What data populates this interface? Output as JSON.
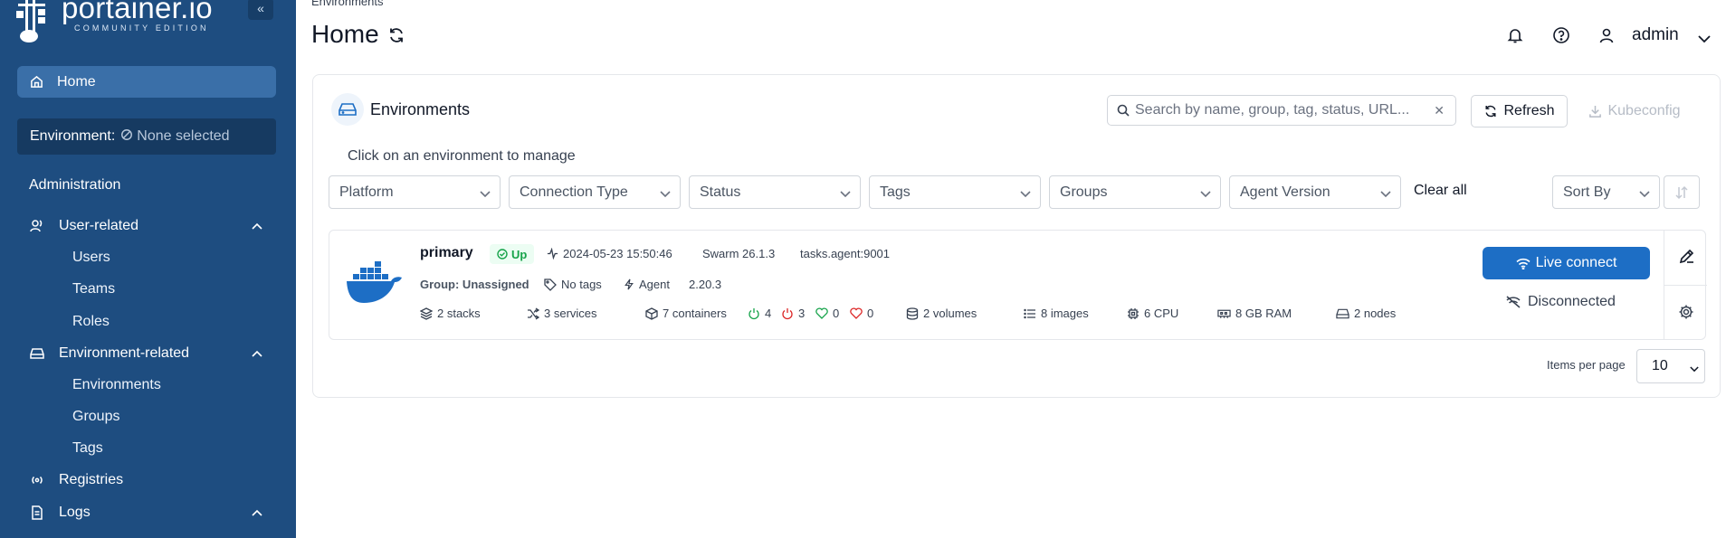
{
  "brand": {
    "title": "portainer.io",
    "subtitle": "COMMUNITY EDITION",
    "collapse": "«"
  },
  "sidebar": {
    "home": "Home",
    "environment_label": "Environment:",
    "environment_value": "None selected",
    "administration": "Administration",
    "user_related": "User-related",
    "users": "Users",
    "teams": "Teams",
    "roles": "Roles",
    "environment_related": "Environment-related",
    "environments": "Environments",
    "groups": "Groups",
    "tags": "Tags",
    "registries": "Registries",
    "logs": "Logs"
  },
  "header": {
    "breadcrumb": "Environments",
    "title": "Home",
    "user": "admin"
  },
  "panel": {
    "title": "Environments",
    "hint": "Click on an environment to manage",
    "search_placeholder": "Search by name, group, tag, status, URL...",
    "refresh": "Refresh",
    "kubeconfig": "Kubeconfig"
  },
  "filters": {
    "platform": "Platform",
    "connection_type": "Connection Type",
    "status": "Status",
    "tags": "Tags",
    "groups": "Groups",
    "agent_version": "Agent Version",
    "clear_all": "Clear all",
    "sort_by": "Sort By"
  },
  "environment": {
    "name": "primary",
    "status": "Up",
    "timestamp": "2024-05-23 15:50:46",
    "swarm": "Swarm 26.1.3",
    "url": "tasks.agent:9001",
    "group": "Group: Unassigned",
    "tags": "No tags",
    "agent": "Agent",
    "agent_version": "2.20.3",
    "stacks": "2 stacks",
    "services": "3 services",
    "containers": "7 containers",
    "running": "4",
    "stopped": "3",
    "healthy": "0",
    "unhealthy": "0",
    "volumes": "2 volumes",
    "images": "8 images",
    "cpu": "6 CPU",
    "ram": "8 GB RAM",
    "nodes": "2 nodes",
    "live_connect": "Live connect",
    "disconnected": "Disconnected"
  },
  "pagination": {
    "label": "Items per page",
    "value": "10"
  },
  "colors": {
    "sidebar": "#1e4d80",
    "accent": "#1d6ec5",
    "success": "#16a34a"
  }
}
